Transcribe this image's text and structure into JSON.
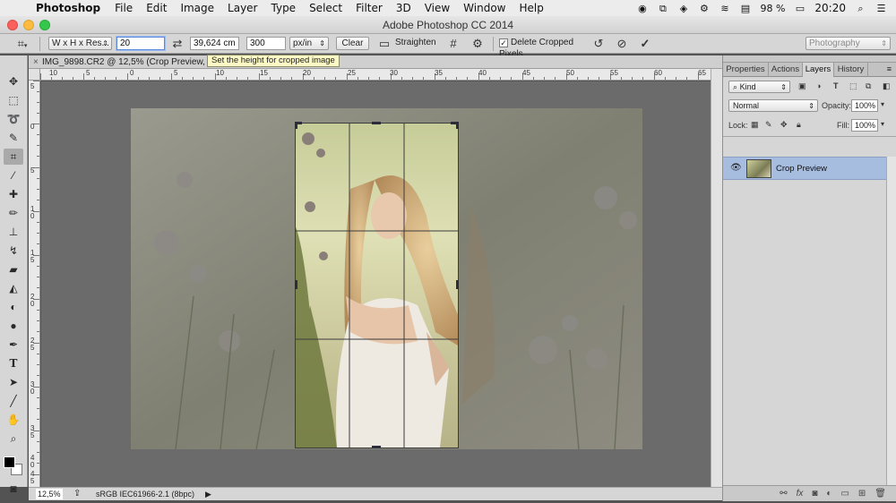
{
  "menubar": {
    "app": "Photoshop",
    "items": [
      "File",
      "Edit",
      "Image",
      "Layer",
      "Type",
      "Select",
      "Filter",
      "3D",
      "View",
      "Window",
      "Help"
    ],
    "battery": "98 %",
    "time": "20:20"
  },
  "window": {
    "title": "Adobe Photoshop CC 2014"
  },
  "options": {
    "ratio_preset": "W x H x Res...",
    "width_value": "20",
    "height_value": "39,624 cm",
    "resolution_value": "300",
    "resolution_unit": "px/in",
    "clear_label": "Clear",
    "straighten_label": "Straighten",
    "delete_cropped_label": "Delete Cropped Pixels",
    "delete_cropped_checked": true,
    "workspace": "Photography"
  },
  "document": {
    "tab_title": "IMG_9898.CR2 @ 12,5% (Crop Preview, RG",
    "tooltip": "Set the height for cropped image",
    "hruler_labels": [
      "10",
      "5",
      "0",
      "5",
      "10",
      "15",
      "20",
      "25",
      "30",
      "35",
      "40",
      "45",
      "50",
      "55",
      "60",
      "65"
    ],
    "vruler_labels": [
      "5",
      "0",
      "5",
      "1 0",
      "1 5",
      "2 0",
      "2 5",
      "3 0",
      "3 5",
      "4 0",
      "4 5"
    ]
  },
  "status": {
    "zoom": "12,5%",
    "profile": "sRGB IEC61966-2.1 (8bpc)"
  },
  "panels": {
    "tabs": [
      "Properties",
      "Actions",
      "Layers",
      "History"
    ],
    "active_tab": "Layers",
    "kind_label": "Kind",
    "blend_mode": "Normal",
    "opacity_label": "Opacity:",
    "opacity_value": "100%",
    "lock_label": "Lock:",
    "fill_label": "Fill:",
    "fill_value": "100%",
    "layers": [
      {
        "name": "Crop Preview",
        "visible": true,
        "selected": true
      }
    ]
  }
}
